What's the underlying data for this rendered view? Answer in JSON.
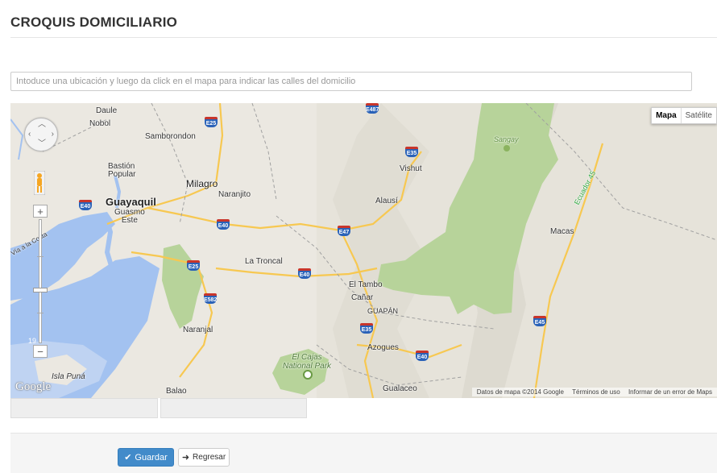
{
  "page": {
    "title": "CROQUIS DOMICILIARIO"
  },
  "search": {
    "placeholder": "Intoduce una ubicación y luego da click en el mapa para indicar las calles del domicilio"
  },
  "map": {
    "type_buttons": {
      "map": "Mapa",
      "satellite": "Satélite",
      "selected": "Mapa"
    },
    "places": {
      "daule": "Daule",
      "nobol": "Nobol",
      "samborondon": "Samborondon",
      "bastion": "Bastión\nPopular",
      "milagro": "Milagro",
      "naranjito": "Naranjito",
      "guayaquil": "Guayaquil",
      "guasmo": "Guasmo\nEste",
      "la_costa": "Vía a la Costa",
      "la_troncal": "La Troncal",
      "naranjal": "Naranjal",
      "isla_puna": "Isla Puná",
      "balao": "Balao",
      "vishut": "Vishut",
      "alausi": "Alausí",
      "el_tambo": "El Tambo",
      "canar": "Cañar",
      "guapan": "GUAPÁN",
      "azogues": "Azogues",
      "gualaceo": "Gualaceo",
      "el_cajas": "El Cajas\nNational Park",
      "sangay": "Sangay",
      "macas": "Macas",
      "ecuador45": "Ecuador 45",
      "marker19": "19"
    },
    "shields": [
      "E487",
      "E25",
      "E35",
      "E40",
      "E40",
      "E47",
      "E25",
      "E40",
      "E582",
      "E35",
      "E40",
      "E45"
    ],
    "footer": {
      "data": "Datos de mapa ©2014 Google",
      "terms": "Términos de uso",
      "report": "Informar de un error de Maps"
    },
    "logo": "Google",
    "zoom": {
      "plus": "+",
      "minus": "−"
    }
  },
  "fields": {
    "field1": "",
    "field2": ""
  },
  "actions": {
    "save": "Guardar",
    "back": "Regresar"
  },
  "colors": {
    "water": "#a3c2f0",
    "land": "#ebe8e1",
    "park": "#b7d39a",
    "road": "#f7c851",
    "primary": "#428bca"
  }
}
